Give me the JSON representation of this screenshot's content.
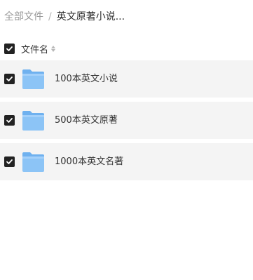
{
  "breadcrumb": {
    "root": "全部文件",
    "separator": "/",
    "current": "英文原著小说..."
  },
  "header": {
    "column_label": "文件名",
    "select_all_checked": true
  },
  "files": [
    {
      "name": "100本英文小说",
      "type": "folder",
      "checked": true
    },
    {
      "name": "500本英文原著",
      "type": "folder",
      "checked": true
    },
    {
      "name": "1000本英文名著",
      "type": "folder",
      "checked": true
    }
  ],
  "colors": {
    "row_background": "#f4f4f4",
    "checkbox": "#222222",
    "folder": "#8cc4f6"
  }
}
